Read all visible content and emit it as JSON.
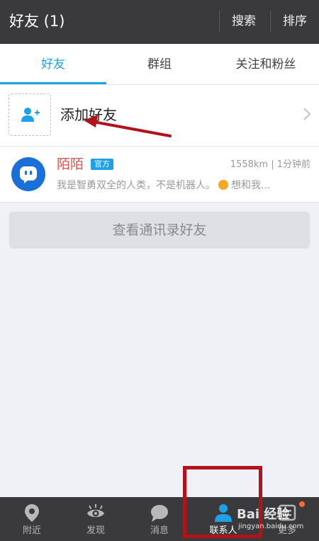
{
  "header": {
    "title": "好友 (1)",
    "search_label": "搜索",
    "sort_label": "排序"
  },
  "tabs": [
    {
      "label": "好友",
      "active": true
    },
    {
      "label": "群组",
      "active": false
    },
    {
      "label": "关注和粉丝",
      "active": false
    }
  ],
  "add_friend": {
    "label": "添加好友",
    "icon": "add-user-icon"
  },
  "contacts": [
    {
      "name": "陌陌",
      "badge": "官方",
      "meta": "1558km | 1分钟前",
      "message_start": "我是智勇双全的人类，不是机器人。",
      "message_end": "想和我..."
    }
  ],
  "address_book_button": "查看通讯录好友",
  "bottom_nav": [
    {
      "label": "附近",
      "icon": "location-pin-icon",
      "active": false
    },
    {
      "label": "发现",
      "icon": "eye-icon",
      "active": false
    },
    {
      "label": "消息",
      "icon": "chat-bubble-icon",
      "active": false
    },
    {
      "label": "联系人",
      "icon": "person-icon",
      "active": true
    },
    {
      "label": "更多",
      "icon": "more-icon",
      "active": false
    }
  ],
  "watermark": {
    "main": "Bai 经验",
    "sub": "jingyan.baidu.com"
  },
  "colors": {
    "accent": "#1ea1e6",
    "header_bg": "#3a3a3c",
    "name_red": "#d9534f",
    "annotation_red": "#b01319"
  }
}
